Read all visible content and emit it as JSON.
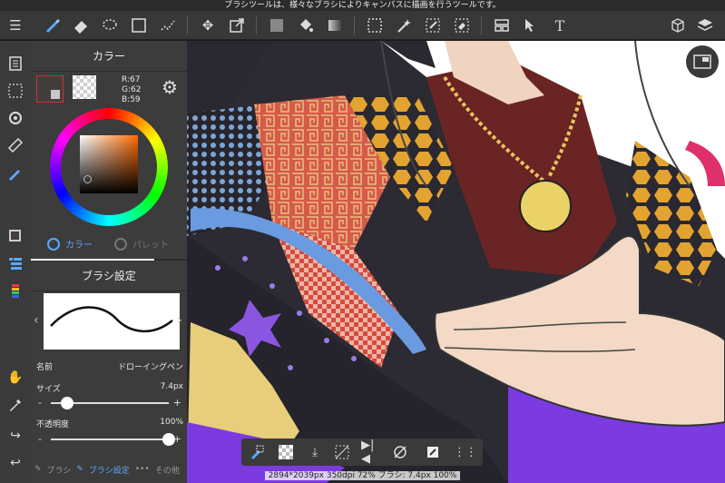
{
  "tooltip": "ブラシツールは、様々なブラシによりキャンバスに描画を行うツールです。",
  "toolbar": {
    "items": [
      "menu-icon",
      "brush-icon",
      "eraser-icon",
      "lasso-fill-icon",
      "rect-select-icon",
      "select-pen-icon",
      "move-icon",
      "transform-icon",
      "fill-color-icon",
      "bucket-icon",
      "gradient-icon",
      "select-dotted-icon",
      "magic-wand-icon",
      "select-pen-tool-icon",
      "select-eraser-icon",
      "panel-layout-icon",
      "operation-icon",
      "text-icon",
      "material-icon",
      "layers-icon"
    ]
  },
  "color_panel": {
    "title": "カラー",
    "r": "R:67",
    "g": "G:62",
    "b": "B:59",
    "tab_color": "カラー",
    "tab_palette": "パレット",
    "main_color": "#433e3b"
  },
  "brush_panel": {
    "title": "ブラシ設定",
    "name_label": "名前",
    "name_value": "ドローイングペン",
    "size_label": "サイズ",
    "size_value": "7.4px",
    "size_fraction": 0.14,
    "opacity_label": "不透明度",
    "opacity_value": "100%",
    "opacity_fraction": 1.0,
    "tab_brush": "ブラシ",
    "tab_settings": "ブラシ設定",
    "tab_other": "その他",
    "minus": "-",
    "plus": "+"
  },
  "status": "2894*2039px 350dpi 72% ブラシ: 7.4px 100%"
}
